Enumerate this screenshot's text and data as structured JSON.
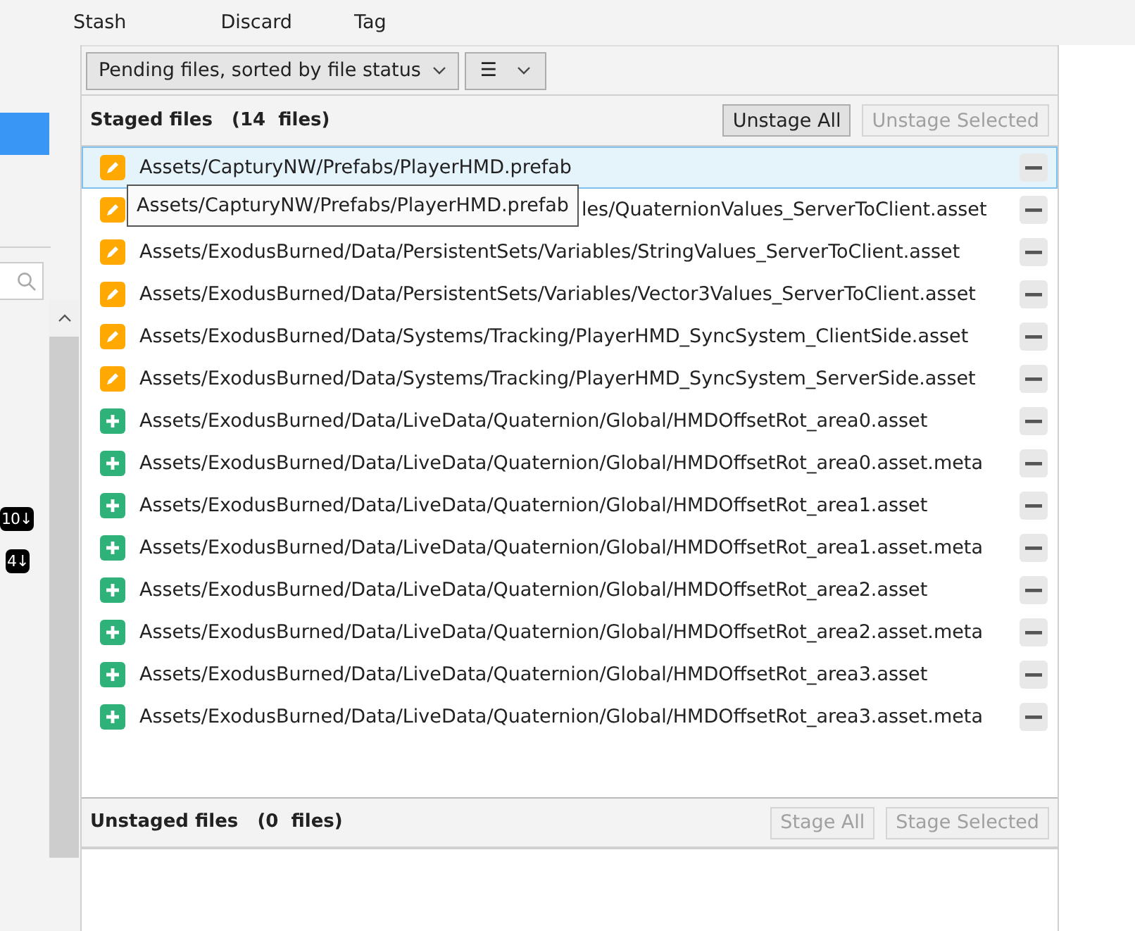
{
  "toolbar": {
    "buttons": [
      "Stash",
      "Discard",
      "Tag"
    ]
  },
  "sidebar": {
    "badges": [
      "10↓",
      "4↓"
    ]
  },
  "view_selector": {
    "label": "Pending files, sorted by file status",
    "menu_glyph": "☰"
  },
  "staged": {
    "title": "Staged files",
    "count": "(14  files)",
    "buttons": [
      {
        "label": "Unstage All",
        "disabled": false
      },
      {
        "label": "Unstage Selected",
        "disabled": true
      }
    ],
    "files": [
      {
        "kind": "modified",
        "path": "Assets/CapturyNW/Prefabs/PlayerHMD.prefab",
        "selected": true
      },
      {
        "kind": "modified",
        "path": "les/QuaternionValues_ServerToClient.asset",
        "selected": false,
        "tooltip": "Assets/CapturyNW/Prefabs/PlayerHMD.prefab"
      },
      {
        "kind": "modified",
        "path": "Assets/ExodusBurned/Data/PersistentSets/Variables/StringValues_ServerToClient.asset",
        "selected": false
      },
      {
        "kind": "modified",
        "path": "Assets/ExodusBurned/Data/PersistentSets/Variables/Vector3Values_ServerToClient.asset",
        "selected": false
      },
      {
        "kind": "modified",
        "path": "Assets/ExodusBurned/Data/Systems/Tracking/PlayerHMD_SyncSystem_ClientSide.asset",
        "selected": false
      },
      {
        "kind": "modified",
        "path": "Assets/ExodusBurned/Data/Systems/Tracking/PlayerHMD_SyncSystem_ServerSide.asset",
        "selected": false
      },
      {
        "kind": "added",
        "path": "Assets/ExodusBurned/Data/LiveData/Quaternion/Global/HMDOffsetRot_area0.asset",
        "selected": false
      },
      {
        "kind": "added",
        "path": "Assets/ExodusBurned/Data/LiveData/Quaternion/Global/HMDOffsetRot_area0.asset.meta",
        "selected": false
      },
      {
        "kind": "added",
        "path": "Assets/ExodusBurned/Data/LiveData/Quaternion/Global/HMDOffsetRot_area1.asset",
        "selected": false
      },
      {
        "kind": "added",
        "path": "Assets/ExodusBurned/Data/LiveData/Quaternion/Global/HMDOffsetRot_area1.asset.meta",
        "selected": false
      },
      {
        "kind": "added",
        "path": "Assets/ExodusBurned/Data/LiveData/Quaternion/Global/HMDOffsetRot_area2.asset",
        "selected": false
      },
      {
        "kind": "added",
        "path": "Assets/ExodusBurned/Data/LiveData/Quaternion/Global/HMDOffsetRot_area2.asset.meta",
        "selected": false
      },
      {
        "kind": "added",
        "path": "Assets/ExodusBurned/Data/LiveData/Quaternion/Global/HMDOffsetRot_area3.asset",
        "selected": false
      },
      {
        "kind": "added",
        "path": "Assets/ExodusBurned/Data/LiveData/Quaternion/Global/HMDOffsetRot_area3.asset.meta",
        "selected": false
      }
    ]
  },
  "unstaged": {
    "title": "Unstaged files",
    "count": "(0  files)",
    "buttons": [
      {
        "label": "Stage All",
        "disabled": true
      },
      {
        "label": "Stage Selected",
        "disabled": true
      }
    ]
  }
}
